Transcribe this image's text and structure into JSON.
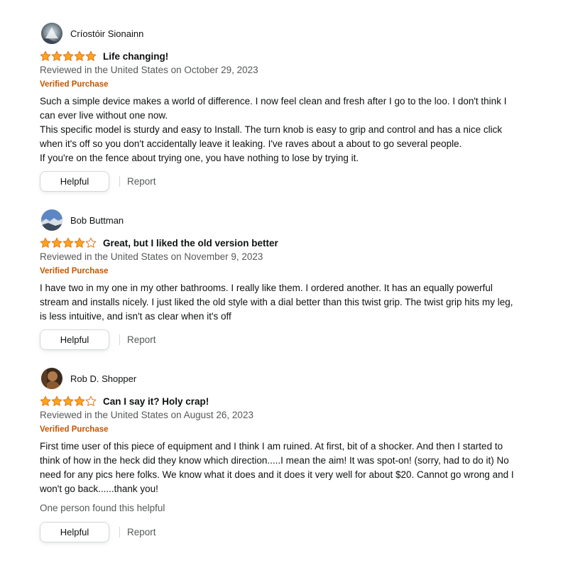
{
  "colors": {
    "star": "#ffa41c",
    "star_outline": "#de7921",
    "verified": "#c45500",
    "secondary_text": "#565959"
  },
  "reviews": [
    {
      "profile_name": "Críostóir Sionainn",
      "avatar_icon": "avatar-waterfall",
      "rating": 5,
      "title": "Life changing!",
      "date": "Reviewed in the United States on October 29, 2023",
      "verified": "Verified Purchase",
      "body": [
        "Such a simple device makes a world of difference. I now feel clean and fresh after I go to the loo. I don't think I can ever live without one now.",
        "This specific model is sturdy and easy to Install. The turn knob is easy to grip and control and has a nice click when it's off so you don't accidentally leave it leaking. I've raves about a about to go several people.",
        "If you're on the fence about trying one, you have nothing to lose by trying it."
      ],
      "helpful_label": "Helpful",
      "report_label": "Report"
    },
    {
      "profile_name": "Bob Buttman",
      "avatar_icon": "avatar-landscape",
      "rating": 4,
      "title": "Great, but I liked the old version better",
      "date": "Reviewed in the United States on November 9, 2023",
      "verified": "Verified Purchase",
      "body": [
        "I have two in my one in my other bathrooms. I really like them. I ordered another. It has an equally powerful stream and installs nicely. I just liked the old style with a dial better than this twist grip. The twist grip hits my leg, is less intuitive, and isn't as clear when it's off"
      ],
      "helpful_label": "Helpful",
      "report_label": "Report"
    },
    {
      "profile_name": "Rob D. Shopper",
      "avatar_icon": "avatar-portrait",
      "rating": 4,
      "title": "Can I say it? Holy crap!",
      "date": "Reviewed in the United States on August 26, 2023",
      "verified": "Verified Purchase",
      "body": [
        "First time user of this piece of equipment and I think I am ruined. At first, bit of a shocker. And then I started to think of how in the heck did they know which direction.....I mean the aim! It was spot-on! (sorry, had to do it) No need for any pics here folks. We know what it does and it does it very well for about $20. Cannot go wrong and I won't go back......thank you!"
      ],
      "helpful_count": "One person found this helpful",
      "helpful_label": "Helpful",
      "report_label": "Report"
    }
  ]
}
